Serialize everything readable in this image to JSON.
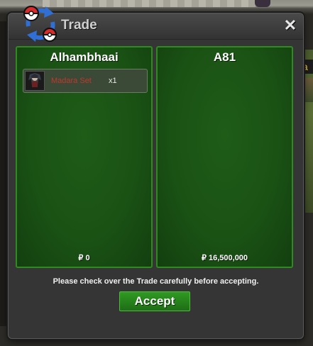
{
  "window": {
    "title": "Trade",
    "close_label": "✕"
  },
  "left_panel": {
    "player_name": "Alhambhaai",
    "items": [
      {
        "name": "Madara Set",
        "quantity": "x1",
        "icon": "outfit-icon"
      }
    ],
    "money": "₽ 0"
  },
  "right_panel": {
    "player_name": "A81",
    "items": [],
    "money": "₽ 16,500,000"
  },
  "notice": "Please check over the Trade carefully before accepting.",
  "accept_label": "Accept",
  "background": {
    "name_tag_fragment": "a"
  },
  "colors": {
    "panel_green": "#1a5214",
    "accept_green": "#2f9a22",
    "item_name_red": "#c2362d"
  }
}
